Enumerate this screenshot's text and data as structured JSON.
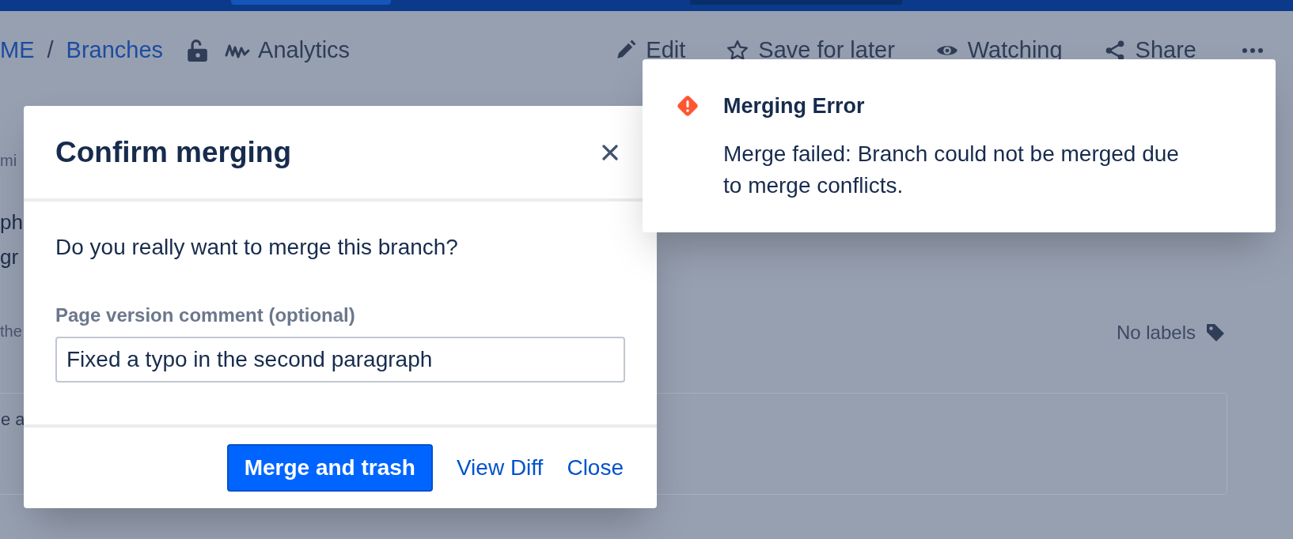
{
  "page": {
    "breadcrumb": [
      {
        "text": "ME",
        "kind": "link"
      },
      {
        "text": "/",
        "kind": "separator"
      },
      {
        "text": "Branches",
        "kind": "link"
      }
    ],
    "analytics": "Analytics",
    "actions": [
      {
        "kind": "edit",
        "label": "Edit"
      },
      {
        "kind": "save",
        "label": "Save for later"
      },
      {
        "kind": "watch",
        "label": "Watching"
      },
      {
        "kind": "share",
        "label": "Share"
      }
    ],
    "fragments": [
      {
        "text": "mi",
        "kind": "meta"
      },
      {
        "text": "ph",
        "kind": "body"
      },
      {
        "text": "gr",
        "kind": "body"
      },
      {
        "text": "the",
        "kind": "meta"
      }
    ],
    "labels_text": "No labels",
    "comment_fragment": "e a"
  },
  "dialog": {
    "title": "Confirm merging",
    "question": "Do you really want to merge this branch?",
    "comment_label": "Page version comment (optional)",
    "comment_value": "Fixed a typo in the second paragraph",
    "buttons": [
      {
        "label": "Merge and trash",
        "kind": "primary"
      },
      {
        "label": "View Diff",
        "kind": "link"
      },
      {
        "label": "Close",
        "kind": "link"
      }
    ]
  },
  "toast": {
    "title": "Merging Error",
    "message": "Merge failed: Branch could not be merged due to merge conflicts."
  }
}
